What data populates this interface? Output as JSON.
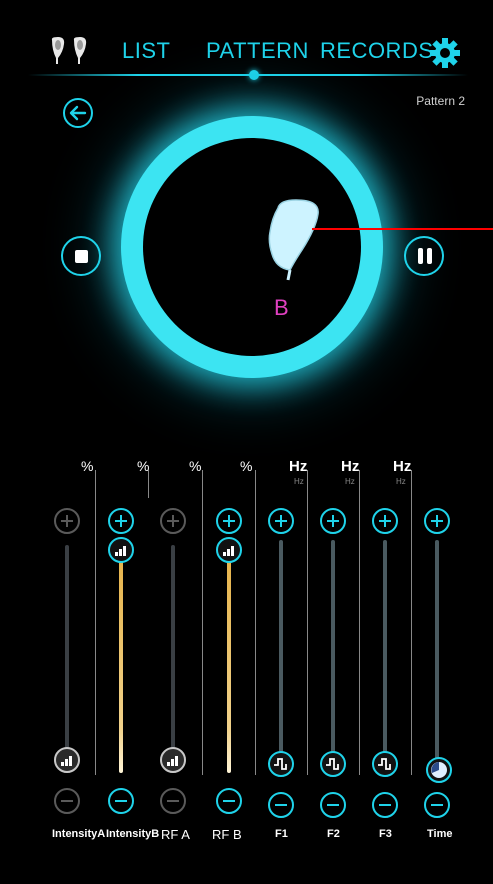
{
  "nav": {
    "list": "LIST",
    "pattern": "PATTERN",
    "records": "RECORDS"
  },
  "pattern_title": "Pattern 2",
  "player": {
    "channel_letter": "B"
  },
  "units": {
    "intensity_a": "%",
    "intensity_b": "%",
    "rf_a": "%",
    "rf_b": "%",
    "f1": "Hz",
    "f2": "Hz",
    "f3": "Hz",
    "f1_sub": "Hz",
    "f2_sub": "Hz",
    "f3_sub": "Hz"
  },
  "columns": [
    {
      "label": "IntensityA",
      "enabled": false,
      "level": 0
    },
    {
      "label": "IntensityB",
      "enabled": true,
      "level": 1
    },
    {
      "label": "RF A",
      "enabled": false,
      "level": 0
    },
    {
      "label": "RF B",
      "enabled": true,
      "level": 1
    },
    {
      "label": "F1",
      "enabled": true,
      "level": 0
    },
    {
      "label": "F2",
      "enabled": true,
      "level": 0
    },
    {
      "label": "F3",
      "enabled": true,
      "level": 0
    },
    {
      "label": "Time",
      "enabled": true,
      "level": 0
    }
  ],
  "colors": {
    "accent": "#1fd3ea",
    "active_track": "#e6b34a",
    "disabled": "#5a5a5a",
    "marker": "#ff0000",
    "letter": "#e040c0"
  },
  "icons": {
    "app": "electrodes-icon",
    "settings": "gear-icon",
    "back": "back-arrow-icon",
    "stop": "stop-icon",
    "pause": "pause-icon"
  }
}
